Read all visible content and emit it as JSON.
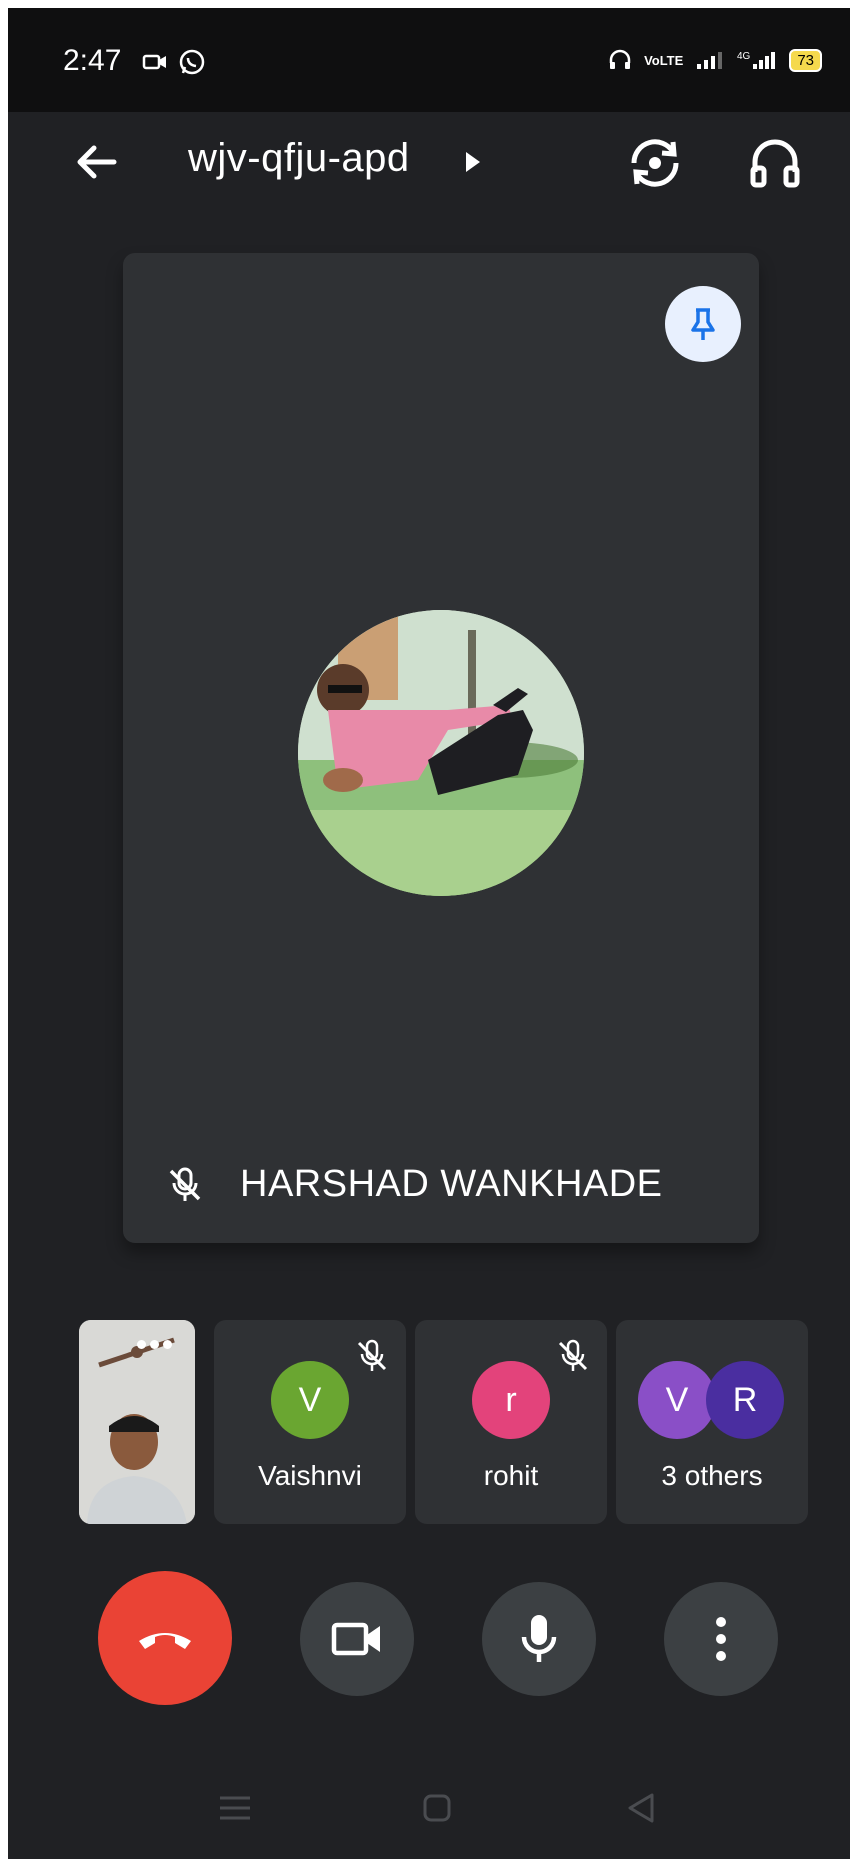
{
  "status_bar": {
    "time": "2:47",
    "battery": "73"
  },
  "header": {
    "meeting_code": "wjv-qfju-apd"
  },
  "main_speaker": {
    "name": "HARSHAD WANKHADE",
    "muted": true
  },
  "participants": [
    {
      "initial": "V",
      "name": "Vaishnvi",
      "color": "#6aa631",
      "muted": true
    },
    {
      "initial": "r",
      "name": "rohit",
      "color": "#e3437b",
      "muted": true
    }
  ],
  "others": {
    "label": "3 others",
    "initials": [
      "V",
      "R"
    ],
    "colors": [
      "#8a4fc7",
      "#4a2ea0"
    ]
  },
  "colors": {
    "background": "#202124",
    "tile": "#2f3134",
    "end_call": "#ea4335",
    "control": "#3c4043",
    "pin_icon": "#1a73e8"
  }
}
